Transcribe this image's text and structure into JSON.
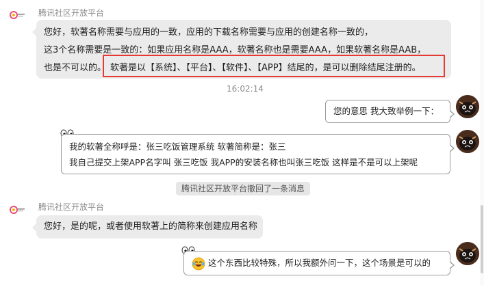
{
  "messages": [
    {
      "sender": "腾讯社区开放平台",
      "lines": [
        "您好，软著名称需要与应用的一致，应用的下载名称需要与应用的创建名称一致的，",
        "这3个名称需要是一致的：如果应用名称是AAA，软著名称也是需要AAA，如果软著名称是AAB，",
        "也是不可以的。"
      ],
      "highlighted": "软著是以【系统】、【平台】、【软件】、【APP】结尾的，是可以删除结尾注册的。"
    }
  ],
  "timestamp": "16:02:14",
  "outgoing": [
    {
      "text": "您的意思 我大致举例一下："
    },
    {
      "lines": [
        "我的软著全称呼是：张三吃饭管理系统  软著简称是：张三",
        "我自己提交上架APP名字叫 张三吃饭    我APP的安装名称也叫张三吃饭  这样是不是可以上架呢"
      ]
    }
  ],
  "recall_notice": "腾讯社区开放平台撤回了一条消息",
  "reply": {
    "sender": "腾讯社区开放平台",
    "text": "您好，是的呢，或者使用软著上的简称来创建应用名称"
  },
  "last_outgoing": {
    "emoji": "laughing-tears-icon",
    "text": "这个东西比较特殊，所以我额外问一下，这个场景是可以的"
  },
  "colors": {
    "highlight_border": "#e53935",
    "incoming_bubble": "#ebebeb",
    "outgoing_border": "#9a9a9a"
  }
}
